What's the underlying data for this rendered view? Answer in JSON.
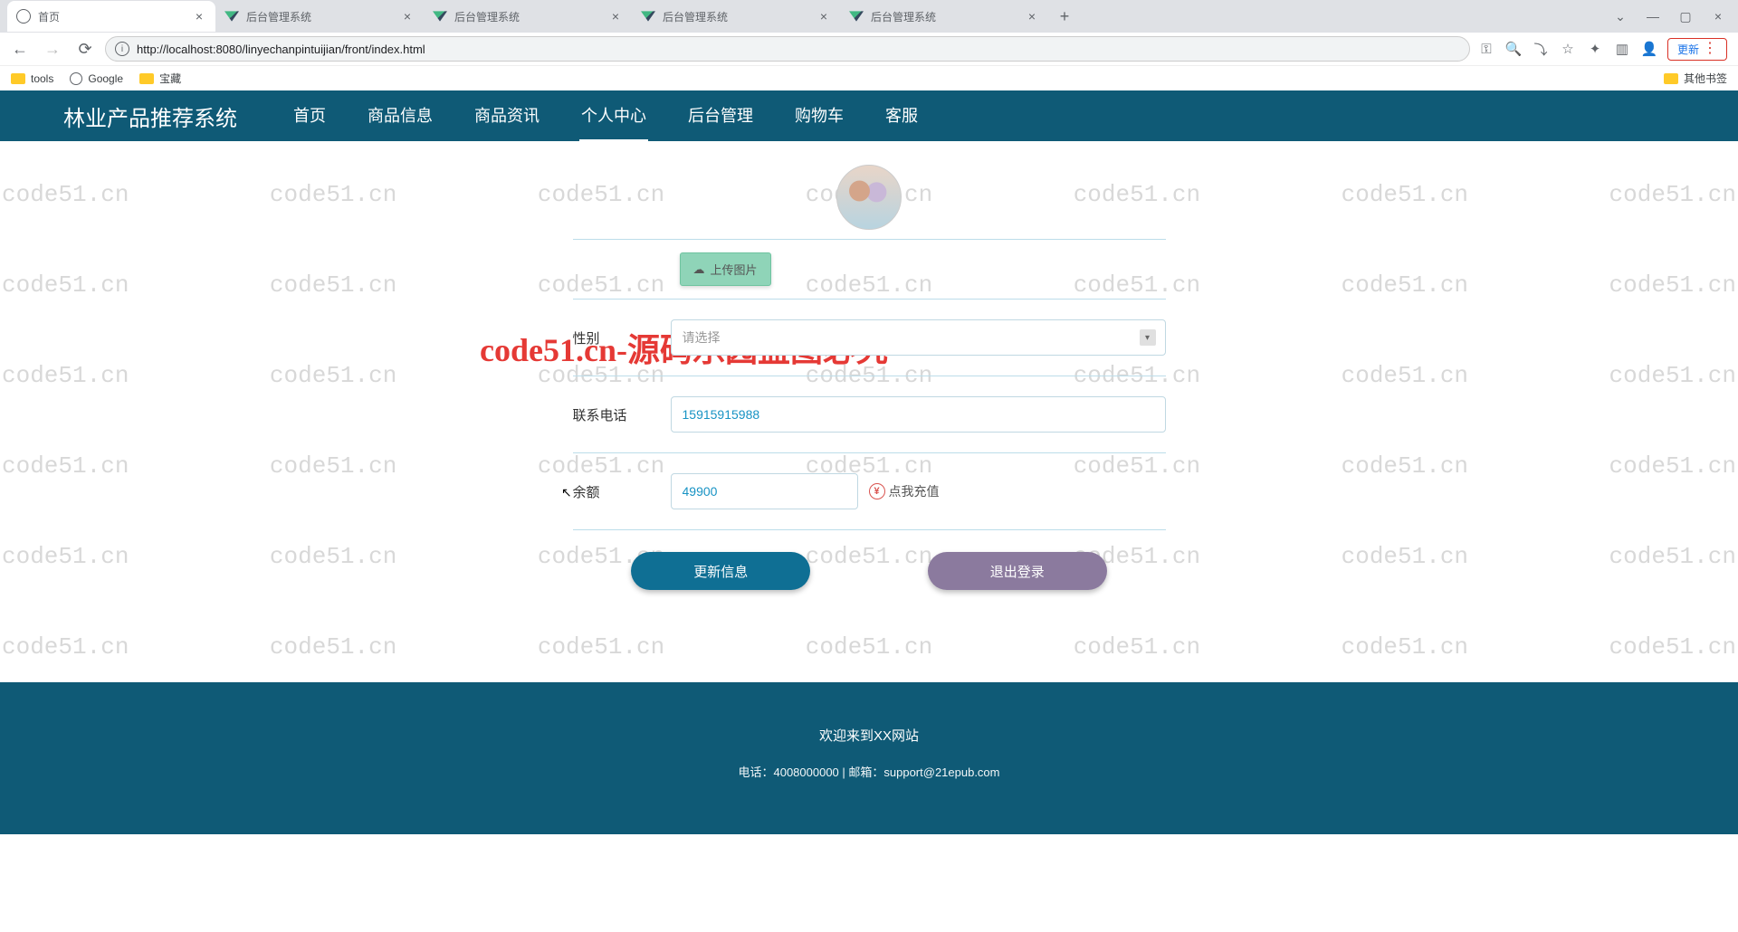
{
  "browser": {
    "tabs": [
      {
        "title": "首页",
        "active": true,
        "favicon": "globe"
      },
      {
        "title": "后台管理系统",
        "active": false,
        "favicon": "vue"
      },
      {
        "title": "后台管理系统",
        "active": false,
        "favicon": "vue"
      },
      {
        "title": "后台管理系统",
        "active": false,
        "favicon": "vue"
      },
      {
        "title": "后台管理系统",
        "active": false,
        "favicon": "vue"
      }
    ],
    "url": "http://localhost:8080/linyechanpintuijian/front/index.html",
    "update_label": "更新",
    "bookmarks": [
      {
        "label": "tools",
        "icon": "folder"
      },
      {
        "label": "Google",
        "icon": "globe"
      },
      {
        "label": "宝藏",
        "icon": "folder"
      }
    ],
    "other_bookmarks": "其他书签"
  },
  "watermark": {
    "text": "code51.cn",
    "banner": "code51.cn-源码乐园盗图必究"
  },
  "header": {
    "site_title": "林业产品推荐系统",
    "nav": [
      "首页",
      "商品信息",
      "商品资讯",
      "个人中心",
      "后台管理",
      "购物车",
      "客服"
    ],
    "active_index": 3
  },
  "form": {
    "upload_label": "上传图片",
    "gender": {
      "label": "性别",
      "placeholder": "请选择"
    },
    "phone": {
      "label": "联系电话",
      "value": "15915915988"
    },
    "balance": {
      "label": "余额",
      "value": "49900",
      "recharge_label": "点我充值"
    },
    "update_btn": "更新信息",
    "logout_btn": "退出登录"
  },
  "footer": {
    "line1": "欢迎来到XX网站",
    "line2": "电话：4008000000 | 邮箱：support@21epub.com"
  }
}
